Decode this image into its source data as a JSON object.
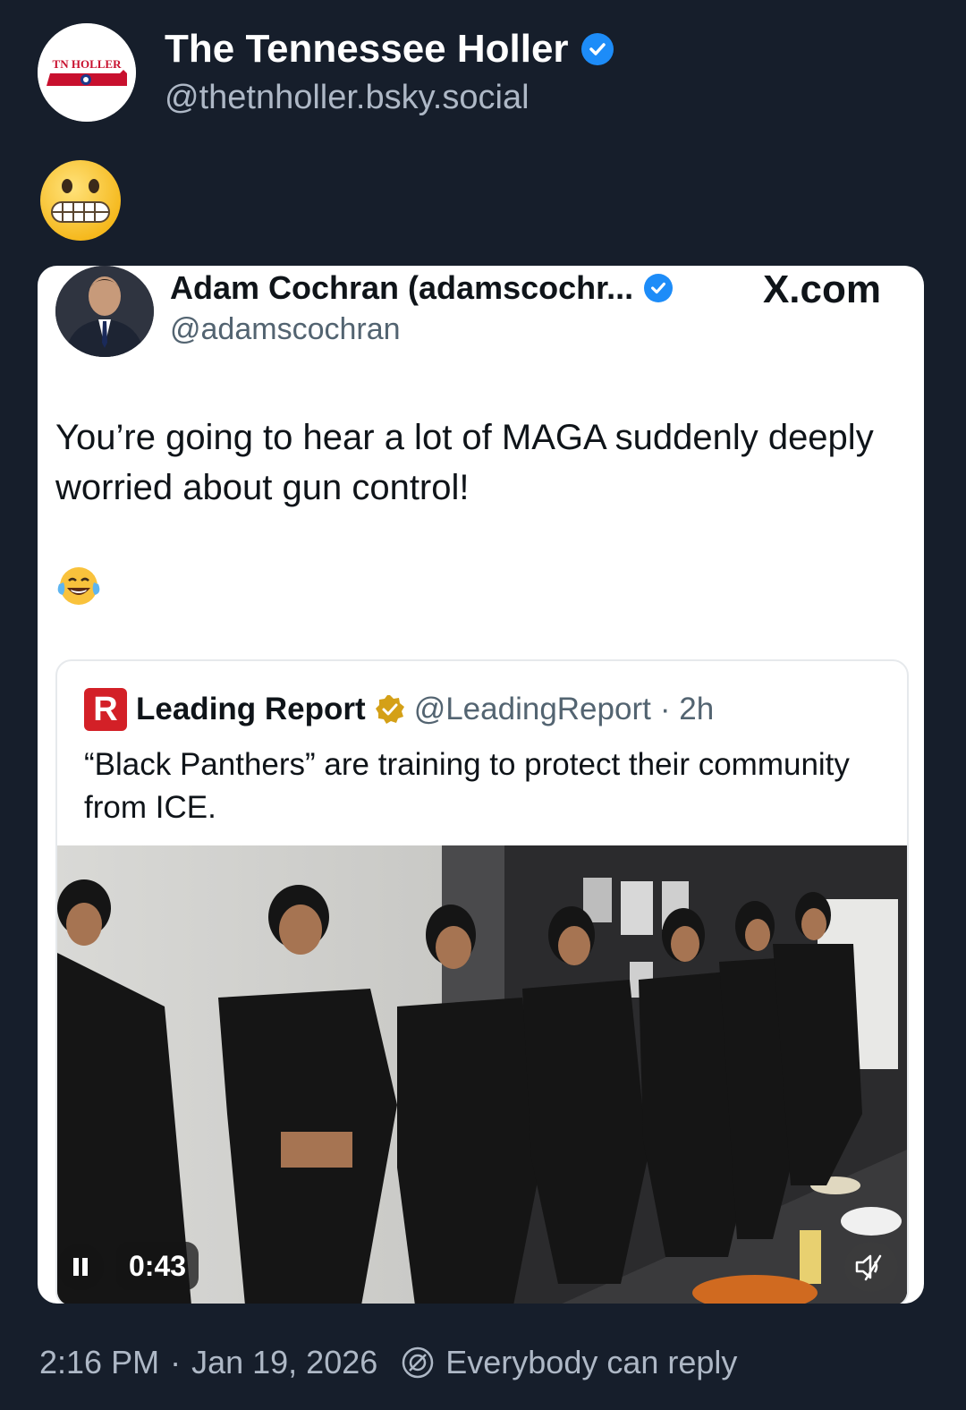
{
  "post": {
    "author_name": "The Tennessee Holler",
    "handle": "@thetnholler.bsky.social",
    "avatar_text": "TN HOLLER",
    "text_emoji": "grimacing-face",
    "timestamp": "2:16 PM",
    "separator": "·",
    "date": "Jan 19, 2026",
    "reply_setting": "Everybody can reply"
  },
  "embedded_tweet": {
    "author_name": "Adam Cochran (adamscochr...",
    "handle": "@adamscochran",
    "source": "X.com",
    "text": "You’re going to hear a lot of MAGA suddenly deeply worried about gun control!",
    "emoji": "face-with-tears-of-joy",
    "quoted": {
      "logo_letter": "R",
      "author_name": "Leading Report",
      "handle": "@LeadingReport",
      "time": "· 2h",
      "text": "“Black Panthers” are training to protect their community from ICE.",
      "video": {
        "duration": "0:43",
        "state": "playing",
        "muted": true
      }
    }
  },
  "colors": {
    "background": "#161e2b",
    "verified_blue": "#1d8cf8",
    "gold_badge": "#d4a017",
    "muted_text": "#aeb8c6"
  }
}
